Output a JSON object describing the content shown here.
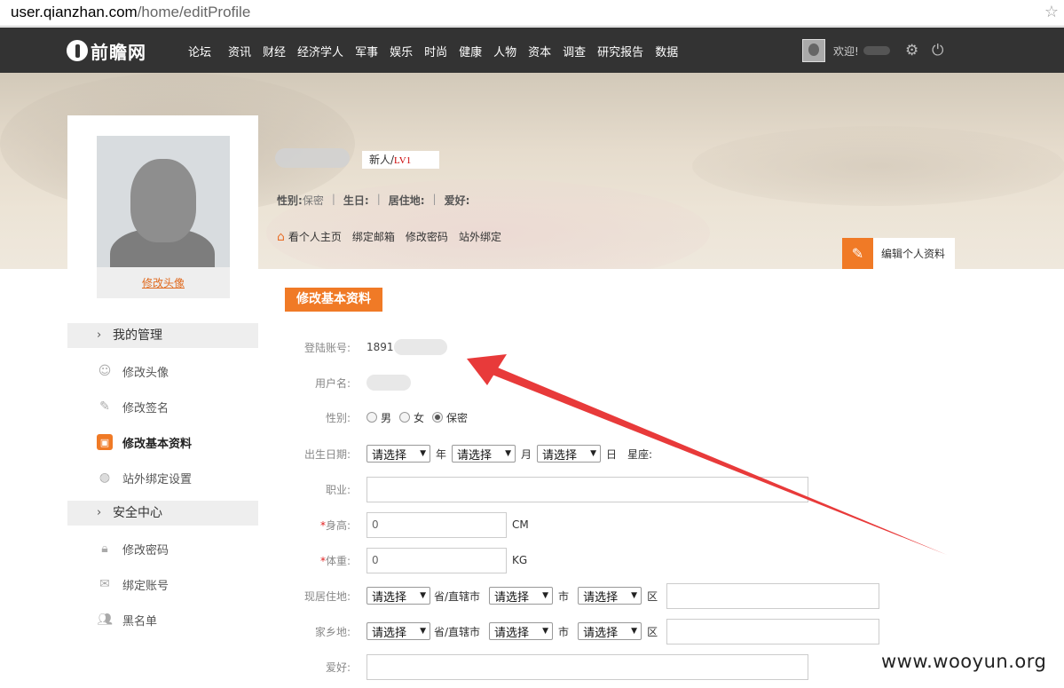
{
  "browser": {
    "url_host": "user.qianzhan.com",
    "url_path": "/home/editProfile"
  },
  "topnav": {
    "logo": "前瞻网",
    "links": [
      "论坛",
      "资讯",
      "财经",
      "经济学人",
      "军事",
      "娱乐",
      "时尚",
      "健康",
      "人物",
      "资本",
      "调查",
      "研究报告",
      "数据"
    ],
    "welcome": "欢迎!",
    "icons": [
      "gear-icon",
      "power-icon"
    ]
  },
  "profile": {
    "badge_prefix": "新人/",
    "badge_level": "LV1",
    "info": [
      {
        "key": "性别:",
        "value": "保密"
      },
      {
        "key": "生日:",
        "value": ""
      },
      {
        "key": "居住地:",
        "value": ""
      },
      {
        "key": "爱好:",
        "value": ""
      }
    ],
    "links": [
      "看个人主页",
      "绑定邮箱",
      "修改密码",
      "站外绑定"
    ],
    "edit_button": "编辑个人资料",
    "avatar_link": "修改头像"
  },
  "sidebar": {
    "sections": [
      {
        "title": "我的管理",
        "items": [
          "修改头像",
          "修改签名",
          "修改基本资料",
          "站外绑定设置"
        ]
      },
      {
        "title": "安全中心",
        "items": [
          "修改密码",
          "绑定账号",
          "黑名单"
        ]
      }
    ],
    "active": "修改基本资料"
  },
  "form": {
    "title": "修改基本资料",
    "account_label": "登陆账号:",
    "account_value": "1891",
    "username_label": "用户名:",
    "gender_label": "性别:",
    "gender_options": [
      "男",
      "女",
      "保密"
    ],
    "gender_selected": "保密",
    "birth_label": "出生日期:",
    "select_placeholder": "请选择",
    "year": "年",
    "month": "月",
    "day": "日",
    "zodiac": "星座:",
    "job_label": "职业:",
    "height_label": "身高:",
    "height_value": "0",
    "height_unit": "CM",
    "weight_label": "体重:",
    "weight_value": "0",
    "weight_unit": "KG",
    "residence_label": "现居住地:",
    "hometown_label": "家乡地:",
    "province": "省/直辖市",
    "city": "市",
    "district": "区",
    "hobby_label": "爱好:",
    "required_mark": "*"
  },
  "watermark": "www.wooyun.org",
  "colors": {
    "accent": "#f07a26",
    "nav_bg": "#333333",
    "arrow": "#e83a3a"
  }
}
